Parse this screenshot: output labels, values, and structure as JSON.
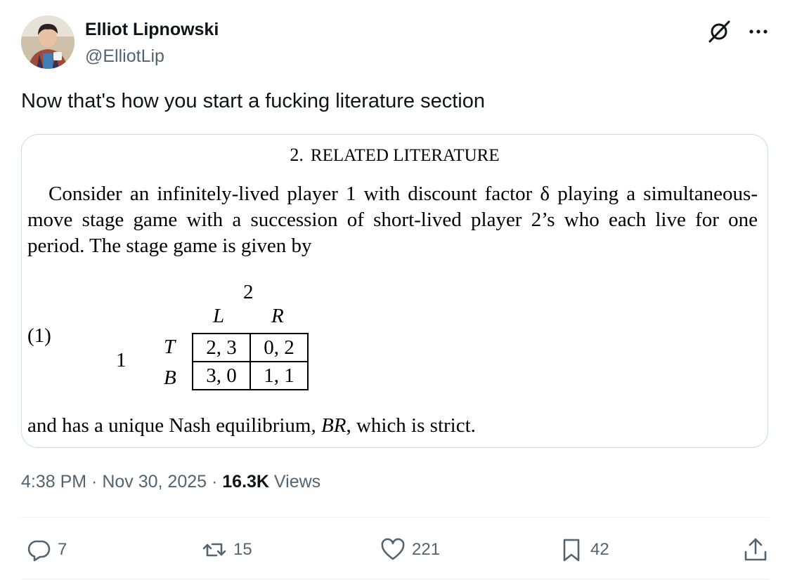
{
  "author": {
    "name": "Elliot Lipnowski",
    "handle": "@ElliotLip"
  },
  "tweet": {
    "text": "Now that's how you start a fucking literature section"
  },
  "image_content": {
    "section_number": "2.",
    "section_title": "RELATED LITERATURE",
    "paragraph_line1": "Consider an infinitely-lived player 1 with discount factor δ playing a simultaneous-move stage game with a succession of short-lived player 2’s who each live for one period. The stage game is given by",
    "equation_label": "(1)",
    "player_col": "2",
    "player_row": "1",
    "col_actions": [
      "L",
      "R"
    ],
    "row_actions": [
      "T",
      "B"
    ],
    "payoffs": [
      [
        "2, 3",
        "0, 2"
      ],
      [
        "3, 0",
        "1, 1"
      ]
    ],
    "conclusion_prefix": "and has a unique Nash equilibrium, ",
    "conclusion_italic": "BR",
    "conclusion_suffix": ", which is strict."
  },
  "meta": {
    "time": "4:38 PM",
    "sep1": " · ",
    "date": "Nov 30, 2025",
    "sep2": " · ",
    "views_count": "16.3K",
    "views_label": " Views"
  },
  "actions": {
    "replies": "7",
    "reposts": "15",
    "likes": "221",
    "bookmarks": "42"
  },
  "icons": {
    "grok": "grok-icon",
    "more": "more-dots-icon",
    "reply": "reply-icon",
    "repost": "repost-icon",
    "like": "heart-icon",
    "bookmark": "bookmark-icon",
    "share": "share-icon"
  },
  "colors": {
    "text": "#0f1419",
    "secondary": "#536471",
    "border": "#cfd9de"
  }
}
